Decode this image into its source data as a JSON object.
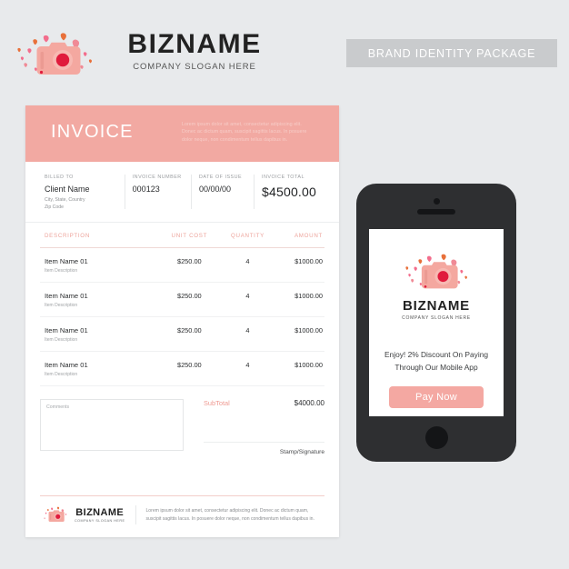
{
  "colors": {
    "page_bg": "#e8eaec",
    "brand_pink": "#f2a9a2",
    "camera_body": "#f4a8a0",
    "camera_body_dark": "#eb9a92",
    "lens_red": "#e01b3c",
    "lens_ring": "#f4a8a0",
    "heart_pink": "#f36d8c",
    "heart_orange": "#e8703a",
    "banner_gray": "#c9cbcd",
    "text_dark": "#222222"
  },
  "logo": {
    "icon": "camera-with-hearts-icon",
    "name": "BIZNAME",
    "slogan": "COMPANY SLOGAN HERE"
  },
  "banner": {
    "label": "BRAND IDENTITY PACKAGE"
  },
  "invoice": {
    "title": "INVOICE",
    "header_lorem": "Lorem ipsum dolor sit amet, consectetur adipiscing elit. Donec ac dictum quam, suscipit sagittis lacus. In posuere dolor neque, non condimentum tellus dapibus in.",
    "billing": [
      {
        "label": "BILLED TO",
        "value": "Client Name",
        "sub1": "City, State, Country",
        "sub2": "Zip Code"
      },
      {
        "label": "INVOICE NUMBER",
        "value": "000123"
      },
      {
        "label": "DATE OF ISSUE",
        "value": "00/00/00"
      },
      {
        "label": "INVOICE TOTAL",
        "value": "$4500.00"
      }
    ],
    "table": {
      "columns": [
        "DESCRIPTION",
        "UNIT COST",
        "QUANTITY",
        "AMOUNT"
      ],
      "rows": [
        {
          "name": "Item Name 01",
          "desc": "Item Description",
          "cost": "$250.00",
          "qty": "4",
          "amount": "$1000.00"
        },
        {
          "name": "Item Name 01",
          "desc": "Item Description",
          "cost": "$250.00",
          "qty": "4",
          "amount": "$1000.00"
        },
        {
          "name": "Item Name 01",
          "desc": "Item Description",
          "cost": "$250.00",
          "qty": "4",
          "amount": "$1000.00"
        },
        {
          "name": "Item Name 01",
          "desc": "Item Description",
          "cost": "$250.00",
          "qty": "4",
          "amount": "$1000.00"
        }
      ]
    },
    "comments_placeholder": "Comments",
    "subtotal_label": "SubTotal",
    "subtotal_value": "$4000.00",
    "stamp_label": "Stamp/Signature",
    "footer": {
      "name": "BIZNAME",
      "slogan": "COMPANY SLOGAN HERE",
      "lorem": "Lorem ipsum dolor sit amet, consectetur adipiscing elit. Donec ac dictum quam, suscipit sagittis lacus. In posuere dolor neque, non condimentum tellus dapibus in."
    }
  },
  "phone": {
    "brand_name": "BIZNAME",
    "brand_slogan": "COMPANY SLOGAN HERE",
    "promo_line1": "Enjoy! 2% Discount On Paying",
    "promo_line2": "Through Our Mobile App",
    "pay_button": "Pay Now"
  }
}
